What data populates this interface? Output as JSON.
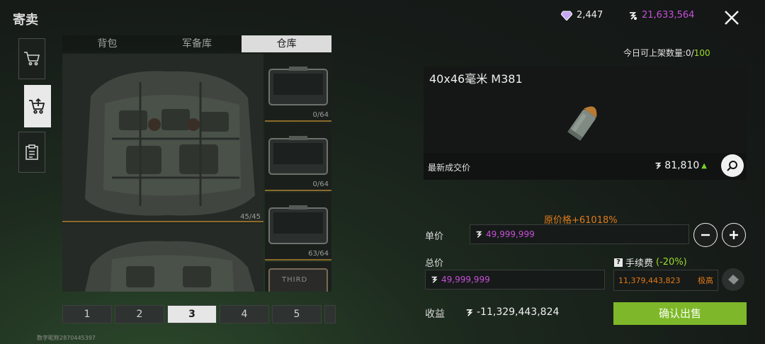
{
  "header": {
    "title": "寄卖"
  },
  "sidebar": {
    "items": [
      {
        "name": "cart",
        "active": false
      },
      {
        "name": "sell-cart",
        "active": true
      },
      {
        "name": "clipboard",
        "active": false
      }
    ]
  },
  "tabs": [
    {
      "label": "背包",
      "active": false
    },
    {
      "label": "军备库",
      "active": false
    },
    {
      "label": "仓库",
      "active": true
    }
  ],
  "inventory": {
    "bags": [
      {
        "count": "45/45"
      },
      {
        "count": ""
      }
    ],
    "cases": [
      {
        "count": "0/64"
      },
      {
        "count": "0/64"
      },
      {
        "count": "63/64"
      },
      {
        "count": "",
        "brand": "THIRD"
      }
    ]
  },
  "pager": {
    "pages": [
      "1",
      "2",
      "3",
      "4",
      "5"
    ],
    "active": "3"
  },
  "footer": {
    "id_text": "数字昵称2870445397"
  },
  "currency": {
    "gems": "2,447",
    "coins": "21,633,564"
  },
  "listing_limit": {
    "label": "今日可上架数量:",
    "current": "0",
    "sep": "/",
    "max": "100"
  },
  "item": {
    "name": "40x46毫米 M381",
    "latest_price_label": "最新成交价",
    "latest_price": "81,810"
  },
  "sell_form": {
    "markup_text": "原价格+61018%",
    "unit_price_label": "单价",
    "unit_price": "49,999,999",
    "total_label": "总价",
    "total_price": "49,999,999",
    "fee_label": "手续费",
    "fee_pct": "(-20%)",
    "fee_value": "11,379,443,823",
    "fee_tag": "极高",
    "profit_label": "收益",
    "profit_value": "-11,329,443,824",
    "confirm_label": "确认出售"
  },
  "colors": {
    "accent_green": "#7eb82a",
    "coin_purple": "#c84fd8",
    "warn_orange": "#e07a1a"
  }
}
